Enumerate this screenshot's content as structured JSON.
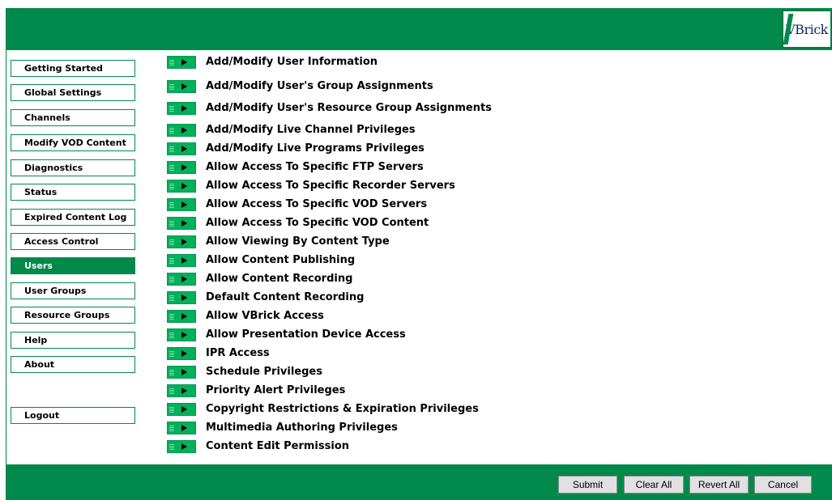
{
  "header": {
    "logo_text": "VBrick"
  },
  "sidebar": {
    "items": [
      {
        "label": "Getting Started"
      },
      {
        "label": "Global Settings"
      },
      {
        "label": "Channels"
      },
      {
        "label": "Modify VOD Content"
      },
      {
        "label": "Diagnostics"
      },
      {
        "label": "Status"
      },
      {
        "label": "Expired Content Log"
      },
      {
        "label": "Access Control"
      },
      {
        "label": "Users",
        "active": true
      },
      {
        "label": "User Groups"
      },
      {
        "label": "Resource Groups"
      },
      {
        "label": "Help"
      },
      {
        "label": "About"
      }
    ],
    "logout_label": "Logout"
  },
  "main": {
    "items": [
      {
        "label": "Add/Modify User Information"
      },
      {
        "label": "Add/Modify User's Group Assignments"
      },
      {
        "label": "Add/Modify User's Resource Group Assignments"
      },
      {
        "label": "Add/Modify Live Channel Privileges"
      },
      {
        "label": "Add/Modify Live Programs Privileges"
      },
      {
        "label": "Allow Access To Specific FTP Servers"
      },
      {
        "label": "Allow Access To Specific Recorder Servers"
      },
      {
        "label": "Allow Access To Specific VOD Servers"
      },
      {
        "label": "Allow Access To Specific VOD Content"
      },
      {
        "label": "Allow Viewing By Content Type"
      },
      {
        "label": "Allow Content Publishing"
      },
      {
        "label": "Allow Content Recording"
      },
      {
        "label": "Default Content Recording"
      },
      {
        "label": "Allow VBrick Access"
      },
      {
        "label": "Allow Presentation Device Access"
      },
      {
        "label": "IPR Access"
      },
      {
        "label": "Schedule Privileges"
      },
      {
        "label": "Priority Alert Privileges"
      },
      {
        "label": "Copyright Restrictions & Expiration Privileges"
      },
      {
        "label": "Multimedia Authoring Privileges"
      },
      {
        "label": "Content Edit Permission"
      }
    ]
  },
  "footer": {
    "submit_label": "Submit",
    "clear_all_label": "Clear All",
    "revert_all_label": "Revert All",
    "cancel_label": "Cancel"
  },
  "colors": {
    "brand_green": "#00894a",
    "arrow_green": "#00b05a"
  }
}
